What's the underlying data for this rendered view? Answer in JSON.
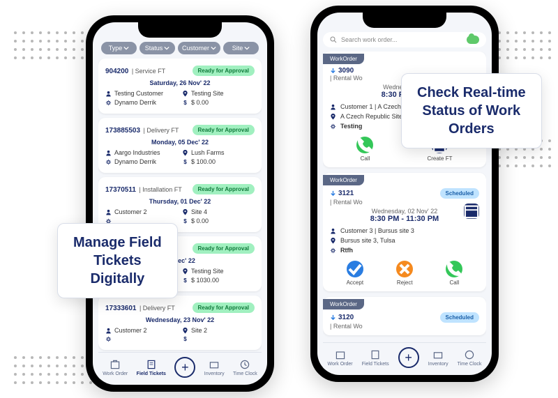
{
  "callouts": {
    "left": "Manage Field\nTickets\nDigitally",
    "right": "Check Real-time\nStatus of Work\nOrders"
  },
  "phone1": {
    "filters": [
      "Type",
      "Status",
      "Customer",
      "Site"
    ],
    "tickets": [
      {
        "id": "904200",
        "type": "Service FT",
        "status": "Ready for Approval",
        "date": "Saturday, 26 Nov' 22",
        "customer": "Testing Customer",
        "site": "Testing Site",
        "user": "Dynamo Derrik",
        "amount": "$ 0.00"
      },
      {
        "id": "173885503",
        "type": "Delivery FT",
        "status": "Ready for Approval",
        "date": "Monday, 05 Dec' 22",
        "customer": "Aargo Industries",
        "site": "Lush Farms",
        "user": "Dynamo Derrik",
        "amount": "$ 100.00"
      },
      {
        "id": "17370511",
        "type": "Installation FT",
        "status": "Ready for Approval",
        "date": "Thursday, 01 Dec' 22",
        "customer": "Customer 2",
        "site": "Site 4",
        "user": "",
        "amount": "$ 0.00"
      },
      {
        "id": "",
        "type": "",
        "status": "Ready for Approval",
        "date": "01 Dec' 22",
        "customer": "",
        "site": "Testing Site",
        "user": "",
        "amount": "$ 1030.00"
      },
      {
        "id": "17333601",
        "type": "Delivery FT",
        "status": "Ready for Approval",
        "date": "Wednesday, 23 Nov' 22",
        "customer": "Customer 2",
        "site": "Site 2",
        "user": "",
        "amount": ""
      }
    ],
    "nav": [
      "Work Order",
      "Field Tickets",
      "",
      "Inventory",
      "Time Clock"
    ]
  },
  "phone2": {
    "search_placeholder": "Search work order...",
    "orders": [
      {
        "tag": "WorkOrder",
        "id": "3090",
        "sub": "Rental Wo",
        "status": "",
        "date": "Wednesday, 02",
        "time": "8:30 PM - 11:",
        "customer": "Customer 1 | A Czech R",
        "site": "A Czech Republic Site",
        "note": "Testing",
        "actions": [
          "Call",
          "Create FT"
        ]
      },
      {
        "tag": "WorkOrder",
        "id": "3121",
        "sub": "Rental Wo",
        "status": "Scheduled",
        "date": "Wednesday, 02 Nov' 22",
        "time": "8:30 PM - 11:30 PM",
        "customer": "Customer 3 | Bursus site 3",
        "site": "Bursus site 3, Tulsa",
        "note": "Rtfh",
        "actions": [
          "Accept",
          "Reject",
          "Call"
        ]
      },
      {
        "tag": "WorkOrder",
        "id": "3120",
        "sub": "Rental Wo",
        "status": "Scheduled",
        "date": "",
        "time": "",
        "customer": "",
        "site": "",
        "note": "",
        "actions": []
      }
    ],
    "nav": [
      "Work Order",
      "Field Tickets",
      "",
      "Inventory",
      "Time Clock"
    ]
  }
}
